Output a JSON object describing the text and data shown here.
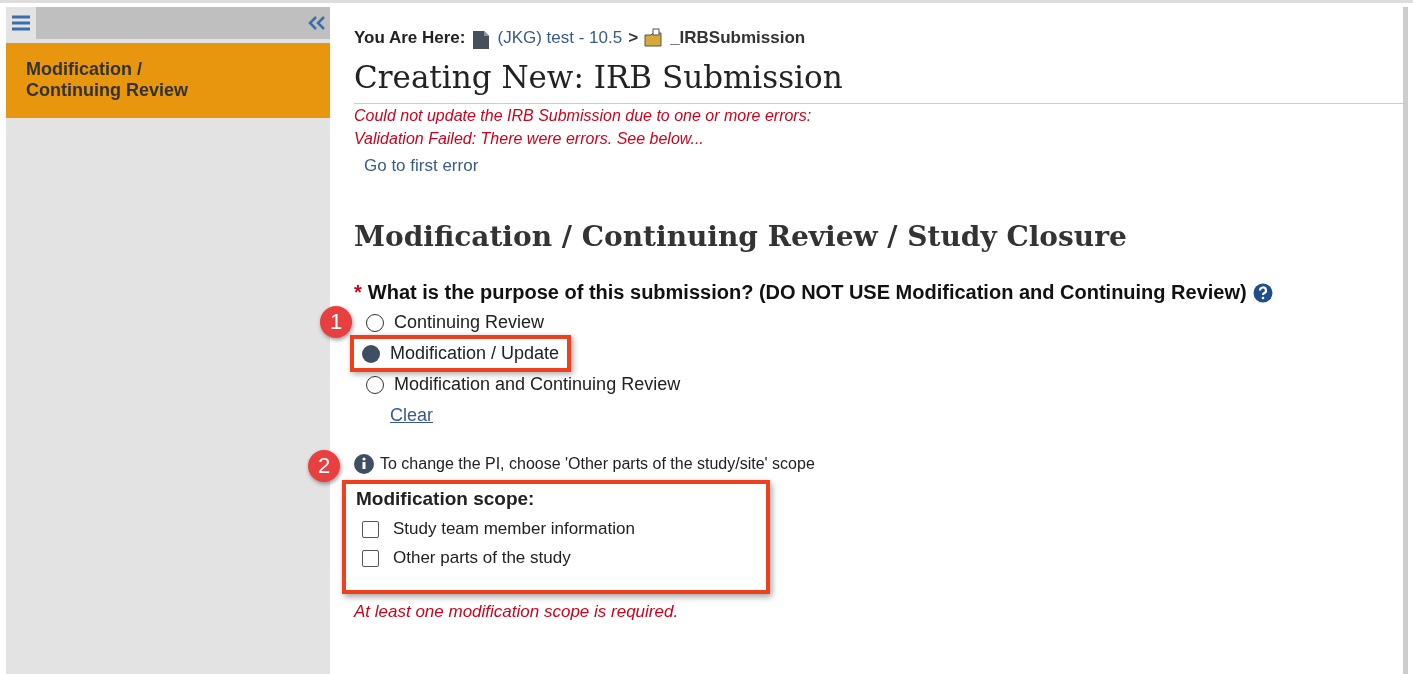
{
  "sidebar": {
    "items": [
      {
        "label": "Modification / Continuing Review",
        "selected": true
      }
    ]
  },
  "breadcrumb": {
    "label": "You Are Here:",
    "items": [
      {
        "text": "(JKG) test - 10.5",
        "kind": "document"
      },
      {
        "text": ">",
        "kind": "separator"
      },
      {
        "text": "_IRBSubmission",
        "kind": "folder"
      }
    ]
  },
  "title": "Creating New: IRB Submission",
  "errors": [
    "Could not update the IRB Submission due to one or more errors:",
    "Validation Failed: There were errors. See below..."
  ],
  "first_error_link": "Go to first error",
  "section_title": "Modification / Continuing Review / Study Closure",
  "question": {
    "required_mark": "*",
    "text": "What is the purpose of this submission? (DO NOT USE Modification and Continuing Review)",
    "badge": "1",
    "options": [
      {
        "label": "Continuing Review",
        "selected": false,
        "highlighted": false
      },
      {
        "label": "Modification / Update",
        "selected": true,
        "highlighted": true
      },
      {
        "label": "Modification and Continuing Review",
        "selected": false,
        "highlighted": false
      }
    ],
    "clear": "Clear"
  },
  "info": {
    "badge": "2",
    "text": "To change the PI, choose 'Other parts of the study/site' scope"
  },
  "scope": {
    "title": "Modification scope:",
    "highlighted": true,
    "options": [
      {
        "label": "Study team member information",
        "checked": false
      },
      {
        "label": "Other parts of the study",
        "checked": false
      }
    ],
    "error": "At least one modification scope is required."
  }
}
